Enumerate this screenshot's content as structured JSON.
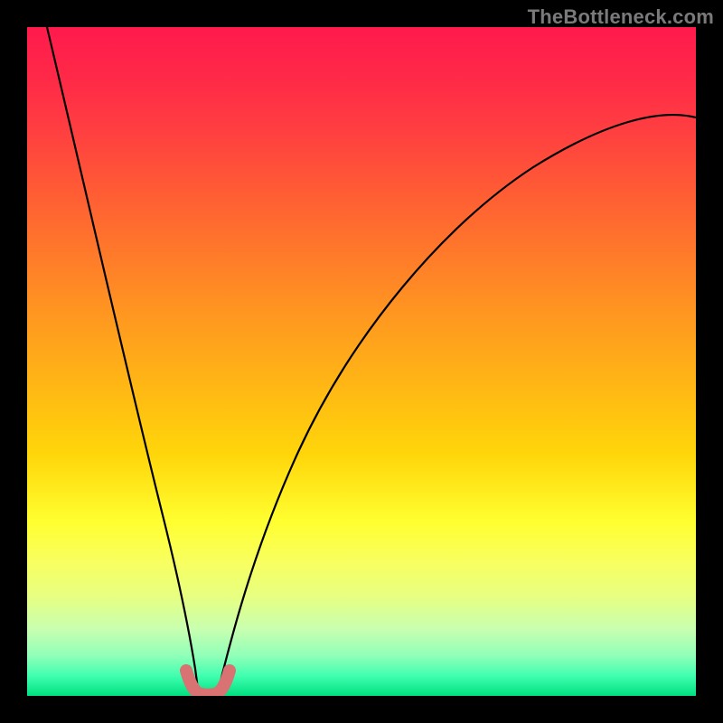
{
  "watermark": "TheBottleneck.com",
  "chart_data": {
    "type": "line",
    "title": "",
    "xlabel": "",
    "ylabel": "",
    "xlim": [
      0,
      100
    ],
    "ylim": [
      0,
      100
    ],
    "grid": false,
    "legend": false,
    "background_gradient": {
      "description": "vertical red→orange→yellow→green",
      "stops": [
        {
          "pct": 0,
          "color": "#ff1a4d"
        },
        {
          "pct": 50,
          "color": "#ffb000"
        },
        {
          "pct": 80,
          "color": "#ffff40"
        },
        {
          "pct": 100,
          "color": "#00e080"
        }
      ]
    },
    "series": [
      {
        "name": "left-branch",
        "color": "#000000",
        "x": [
          3,
          5,
          8,
          11,
          14,
          17,
          19,
          21,
          22.5,
          24,
          25.5
        ],
        "y": [
          100,
          88,
          72,
          56,
          42,
          30,
          20,
          12,
          7,
          3,
          0
        ]
      },
      {
        "name": "right-branch",
        "color": "#000000",
        "x": [
          28.5,
          30,
          33,
          37,
          42,
          50,
          60,
          72,
          85,
          100
        ],
        "y": [
          0,
          3,
          12,
          25,
          38,
          52,
          64,
          74,
          81,
          86
        ]
      },
      {
        "name": "minimum-highlight",
        "color": "#d96a6a",
        "x": [
          24,
          25,
          25.5,
          27,
          28.5,
          29,
          30
        ],
        "y": [
          3,
          1,
          0,
          0,
          0,
          1,
          3
        ]
      }
    ],
    "notes": "V-shaped bottleneck curve; minimum near x≈27, y≈0. Values estimated from pixel positions; no axis ticks or labels visible."
  }
}
